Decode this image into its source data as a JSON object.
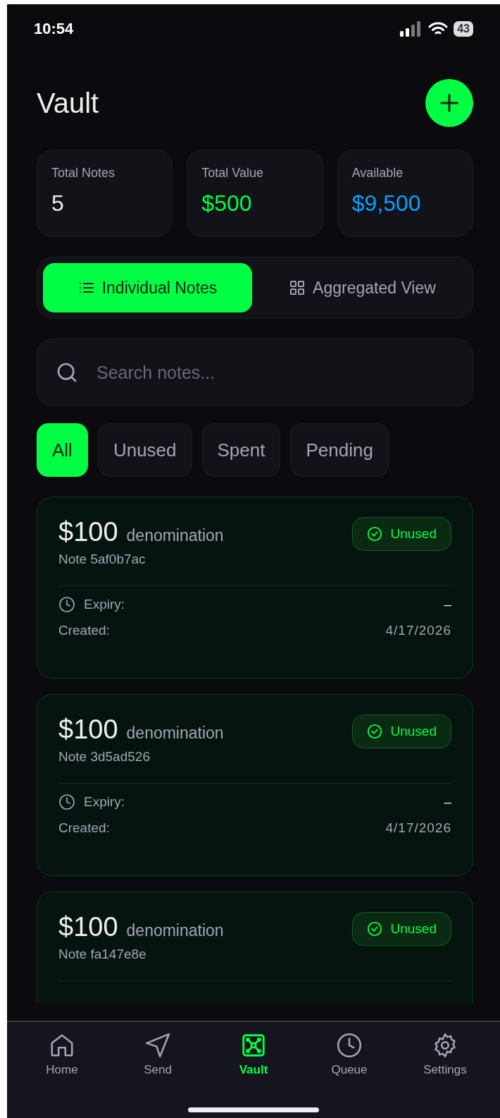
{
  "status_bar": {
    "time": "10:54",
    "battery": "43"
  },
  "header": {
    "title": "Vault"
  },
  "stats": [
    {
      "label": "Total Notes",
      "value": "5",
      "kind": "plain"
    },
    {
      "label": "Total Value",
      "value": "$500",
      "kind": "green"
    },
    {
      "label": "Available",
      "value": "$9,500",
      "kind": "blue"
    }
  ],
  "view_toggle": [
    {
      "label": "Individual Notes",
      "kind": "list",
      "selected": true
    },
    {
      "label": "Aggregated View",
      "kind": "grid",
      "selected": false
    }
  ],
  "search": {
    "placeholder": "Search notes..."
  },
  "filters": [
    {
      "label": "All",
      "selected": true
    },
    {
      "label": "Unused",
      "selected": false
    },
    {
      "label": "Spent",
      "selected": false
    },
    {
      "label": "Pending",
      "selected": false
    }
  ],
  "notes": [
    {
      "amount": "$100",
      "unit": "denomination",
      "id": "Note 5af0b7ac",
      "status": "Unused",
      "expiry_label": "Expiry:",
      "expiry": "–",
      "created_label": "Created:",
      "created": "4/17/2026"
    },
    {
      "amount": "$100",
      "unit": "denomination",
      "id": "Note 3d5ad526",
      "status": "Unused",
      "expiry_label": "Expiry:",
      "expiry": "–",
      "created_label": "Created:",
      "created": "4/17/2026"
    },
    {
      "amount": "$100",
      "unit": "denomination",
      "id": "Note fa147e8e",
      "status": "Unused"
    }
  ],
  "nav": [
    {
      "label": "Home",
      "kind": "home",
      "selected": false
    },
    {
      "label": "Send",
      "kind": "send",
      "selected": false
    },
    {
      "label": "Vault",
      "kind": "vault",
      "selected": true
    },
    {
      "label": "Queue",
      "kind": "clock",
      "selected": false
    },
    {
      "label": "Settings",
      "kind": "gear",
      "selected": false
    }
  ]
}
